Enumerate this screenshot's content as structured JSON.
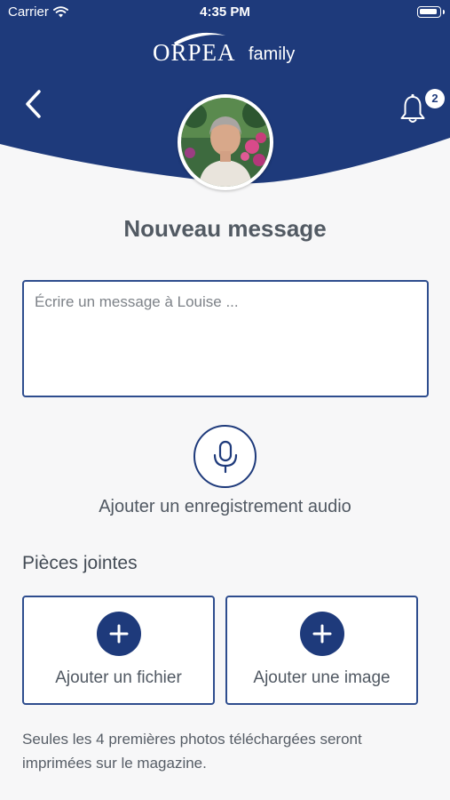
{
  "colors": {
    "brand": "#1e3a7b",
    "background": "#f7f7f8",
    "text": "#505862"
  },
  "status_bar": {
    "carrier": "Carrier",
    "time": "4:35 PM"
  },
  "header": {
    "logo_main": "ORPEA",
    "logo_sub": "family",
    "notification_count": "2"
  },
  "main": {
    "title": "Nouveau message",
    "message_placeholder": "Écrire un message à Louise ...",
    "message_value": "",
    "audio_label": "Ajouter un enregistrement audio",
    "attachments_title": "Pièces jointes",
    "add_file_label": "Ajouter un fichier",
    "add_image_label": "Ajouter une image",
    "note": "Seules les 4 premières photos téléchargées seront imprimées sur le magazine."
  },
  "icons": {
    "back": "chevron-left-icon",
    "notifications": "bell-icon",
    "audio": "microphone-icon",
    "add": "plus-icon",
    "wifi": "wifi-icon",
    "battery": "battery-icon"
  }
}
